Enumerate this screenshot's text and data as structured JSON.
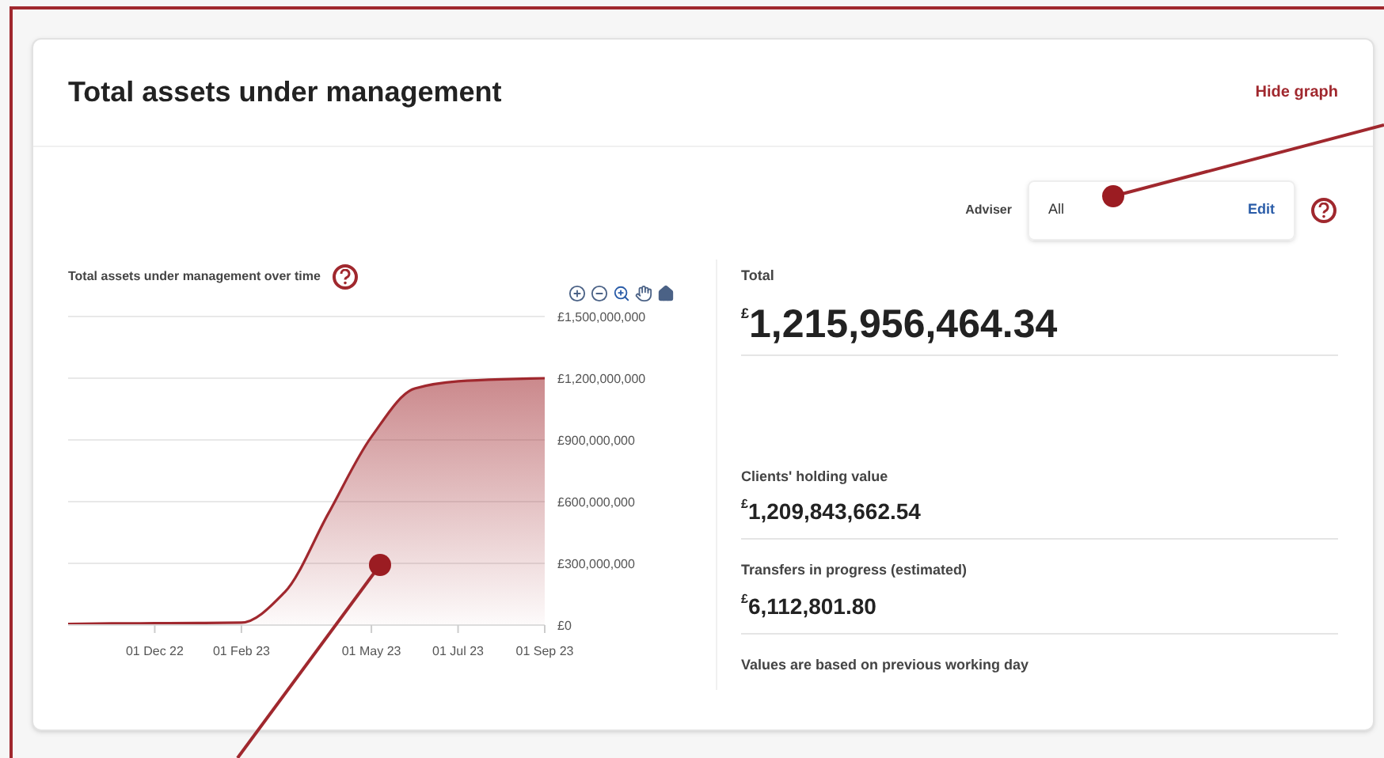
{
  "header": {
    "title": "Total assets under management",
    "link": "Hide graph"
  },
  "adviser": {
    "label": "Adviser",
    "value": "All",
    "action": "Edit"
  },
  "chart": {
    "title": "Total assets under management over time",
    "chart_data": {
      "type": "area",
      "categories": [
        null,
        null,
        "01 Dec 22",
        null,
        "01 Feb 23",
        null,
        null,
        "01 May 23",
        null,
        "01 Jul 23",
        null,
        "01 Sep 23"
      ],
      "series": [
        {
          "color": "#a0282e",
          "values": [
            5000000,
            8000000,
            9000000,
            10000000,
            12000000,
            160000000,
            540000000,
            915000000,
            1150000000,
            1185000000,
            1195000000,
            1200000000
          ]
        }
      ],
      "ylim": [
        0,
        1500000000
      ],
      "grid": true,
      "yticks": [
        {
          "value": 0,
          "label": "£0"
        },
        {
          "value": 300000000,
          "label": "£300,000,000"
        },
        {
          "value": 600000000,
          "label": "£600,000,000"
        },
        {
          "value": 900000000,
          "label": "£900,000,000"
        },
        {
          "value": 1200000000,
          "label": "£1,200,000,000"
        },
        {
          "value": 1500000000,
          "label": "£1,500,000,000"
        }
      ]
    }
  },
  "summary": {
    "total": {
      "label": "Total",
      "currency": "£",
      "value": "1,215,956,464.34"
    },
    "items": [
      {
        "label": "Clients' holding value",
        "currency": "£",
        "value": "1,209,843,662.54"
      },
      {
        "label": "Transfers in progress (estimated)",
        "currency": "£",
        "value": "6,112,801.80"
      }
    ],
    "note": "Values are based on previous working day"
  }
}
